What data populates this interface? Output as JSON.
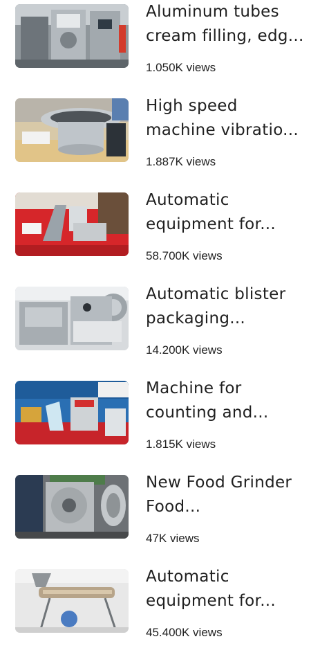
{
  "videos": [
    {
      "title": "Aluminum tubes cream filling, edg...",
      "views": "1.050K views",
      "thumb_icon": "filling-machine-thumbnail"
    },
    {
      "title": "High speed machine vibratio...",
      "views": "1.887K views",
      "thumb_icon": "vibration-bowl-thumbnail"
    },
    {
      "title": "Automatic equipment for...",
      "views": "58.700K views",
      "thumb_icon": "red-equipment-thumbnail"
    },
    {
      "title": "Automatic blister packaging...",
      "views": "14.200K views",
      "thumb_icon": "blister-machine-thumbnail"
    },
    {
      "title": "Machine for counting and...",
      "views": "1.815K views",
      "thumb_icon": "counting-machine-thumbnail"
    },
    {
      "title": "New Food Grinder Food...",
      "views": "47K views",
      "thumb_icon": "food-grinder-thumbnail"
    },
    {
      "title": "Automatic equipment for...",
      "views": "45.400K views",
      "thumb_icon": "steel-equipment-thumbnail"
    }
  ]
}
